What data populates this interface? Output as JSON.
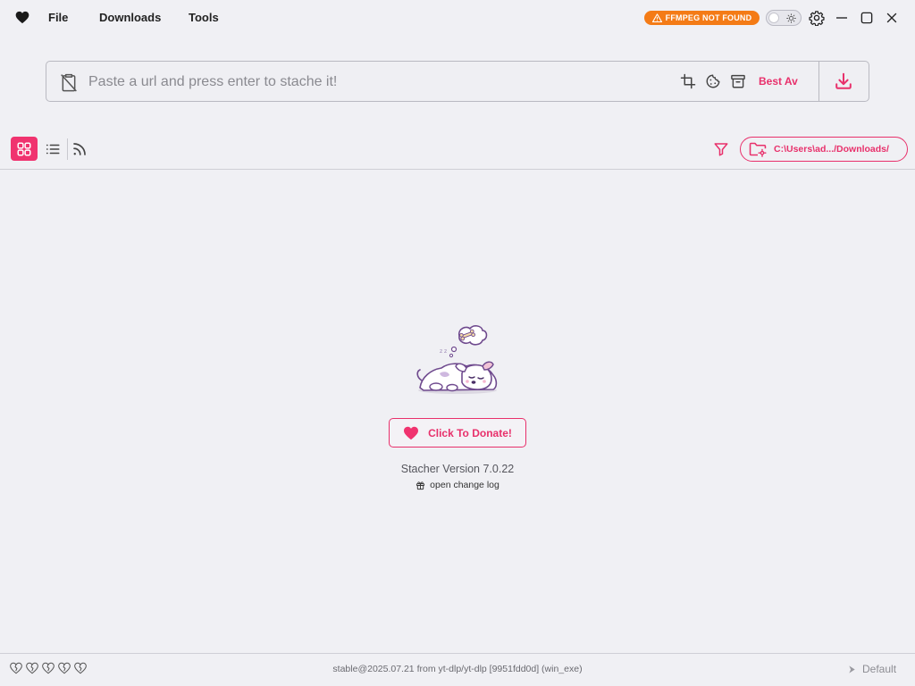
{
  "titlebar": {
    "menu": [
      "File",
      "Downloads",
      "Tools"
    ],
    "ffmpeg_warning": "FFMPEG NOT FOUND",
    "colors": {
      "accent": "#e8306b",
      "warning": "#f47b16"
    }
  },
  "urlbar": {
    "placeholder": "Paste a url and press enter to stache it!",
    "value": "",
    "format_label": "Best Av",
    "icons": [
      "clipboard-off-icon",
      "crop-icon",
      "cookie-icon",
      "archive-icon",
      "download-icon"
    ]
  },
  "toolbar": {
    "views": [
      "grid-view",
      "list-view",
      "rss-view"
    ],
    "download_path": "C:\\Users\\ad.../Downloads/"
  },
  "main": {
    "donate_label": "Click To Donate!",
    "version": "Stacher Version 7.0.22",
    "changelog_label": "open change log"
  },
  "footer": {
    "ytdlp_version": "stable@2025.07.21 from yt-dlp/yt-dlp [9951fdd0d] (win_exe)",
    "profile": "Default",
    "hearts": 5
  }
}
